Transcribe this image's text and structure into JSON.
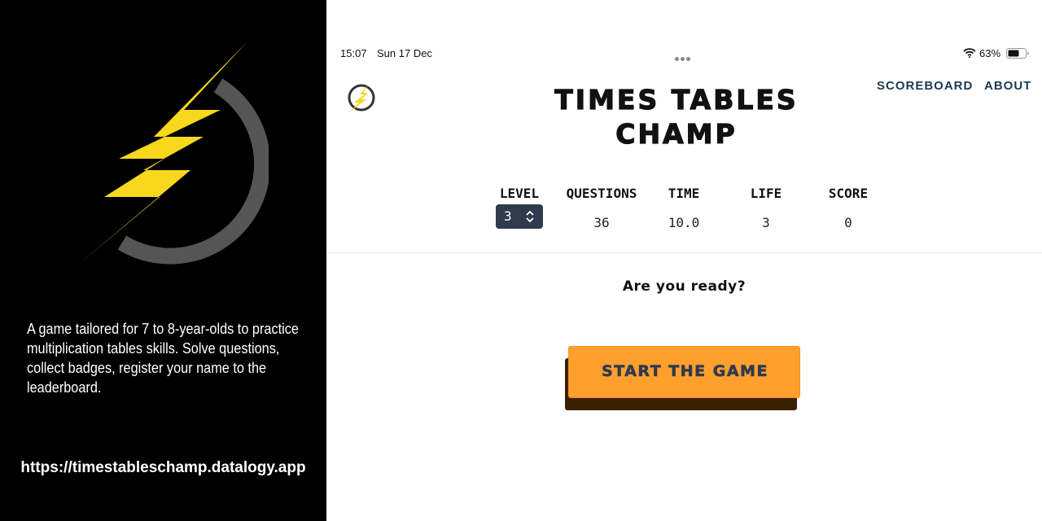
{
  "promo": {
    "description": "A game tailored for 7 to 8-year-olds to practice multiplication tables skills. Solve questions, collect badges, register your name to the leaderboard.",
    "url": "https://timestableschamp.datalogy.app",
    "logo_icon": "lightning-bolt-icon"
  },
  "status_bar": {
    "time": "15:07",
    "date": "Sun 17 Dec",
    "battery_pct": "63%"
  },
  "header": {
    "title_line1": "TIMES TABLES",
    "title_line2": "CHAMP",
    "nav": {
      "scoreboard": "SCOREBOARD",
      "about": "ABOUT"
    }
  },
  "stats": {
    "level": {
      "label": "LEVEL",
      "value": "3"
    },
    "questions": {
      "label": "QUESTIONS",
      "value": "36"
    },
    "time": {
      "label": "TIME",
      "value": "10.0"
    },
    "life": {
      "label": "LIFE",
      "value": "3"
    },
    "score": {
      "label": "SCORE",
      "value": "0"
    }
  },
  "main": {
    "prompt": "Are you ready?",
    "start_label": "START THE GAME"
  },
  "colors": {
    "accent": "#ff9f2e",
    "bolt": "#f7d81c",
    "nav": "#1e3a52",
    "select_bg": "#2f3b4c"
  }
}
